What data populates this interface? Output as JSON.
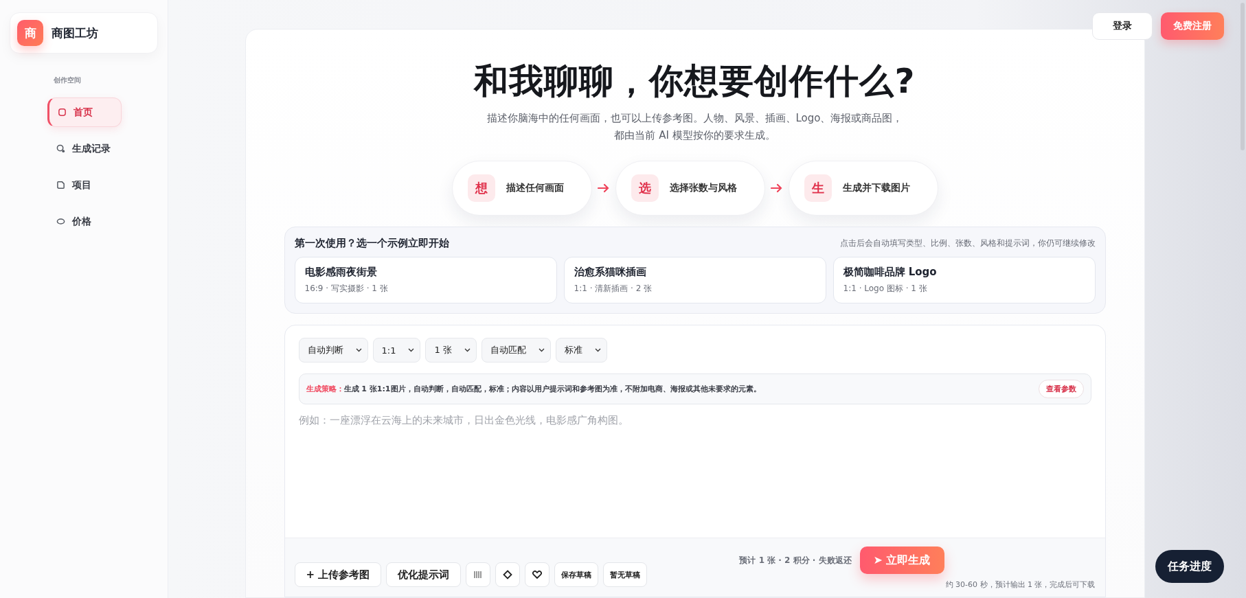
{
  "brand": {
    "logo": "商",
    "name": "商图工坊"
  },
  "sidebar": {
    "section": "创作空间",
    "items": [
      {
        "label": "首页",
        "selected": true,
        "kind": "square"
      },
      {
        "label": "生成记录",
        "selected": false,
        "kind": "search"
      },
      {
        "label": "项目",
        "selected": false,
        "kind": "folder"
      },
      {
        "label": "价格",
        "selected": false,
        "kind": "tag"
      }
    ]
  },
  "header": {
    "login": "登录",
    "register": "免费注册"
  },
  "hero": {
    "title": "和我聊聊，你想要创作什么?",
    "subtitle_lines": [
      "描述你脑海中的任何画面，也可以上传参考图。人物、风景、插画、Logo、海报或商品图，",
      "都由当前 AI 模型按你的要求生成。"
    ]
  },
  "steps": [
    {
      "badge": "想",
      "label": "描述任何画面"
    },
    {
      "badge": "选",
      "label": "选择张数与风格"
    },
    {
      "badge": "生",
      "label": "生成并下载图片"
    }
  ],
  "examples": {
    "title": "第一次使用？选一个示例立即开始",
    "hint": "点击后会自动填写类型、比例、张数、风格和提示词，你仍可继续修改",
    "items": [
      {
        "title": "电影感雨夜街景",
        "meta": "16:9 · 写实摄影 · 1 张"
      },
      {
        "title": "治愈系猫咪插画",
        "meta": "1:1 · 清新插画 · 2 张"
      },
      {
        "title": "极简咖啡品牌 Logo",
        "meta": "1:1 · Logo 图标 · 1 张"
      }
    ]
  },
  "composer": {
    "selects": [
      "自动判断",
      "1:1",
      "1 张",
      "自动匹配",
      "标准"
    ],
    "strategy": {
      "label": "生成策略：",
      "text": "生成 1 张1:1图片，自动判断，自动匹配，标准；内容以用户提示词和参考图为准，不附加电商、海报或其他未要求的元素。",
      "button": "查看参数"
    },
    "placeholder": "例如：一座漂浮在云海上的未来城市，日出金色光线，电影感广角构图。",
    "tools": [
      {
        "kind": "text",
        "label": "+ 上传参考图"
      },
      {
        "kind": "text",
        "label": "优化提示词"
      },
      {
        "kind": "grid"
      },
      {
        "kind": "diamond"
      },
      {
        "kind": "heart"
      },
      {
        "kind": "small",
        "label": "保存草稿"
      },
      {
        "kind": "small",
        "label": "暂无草稿"
      }
    ],
    "estimate": "预计 1 张 · 2 积分 · 失败返还",
    "generate": "➤ 立即生成",
    "eta": "约 30-60 秒，预计输出 1 张，完成后可下载"
  },
  "task_button": "任务进度"
}
